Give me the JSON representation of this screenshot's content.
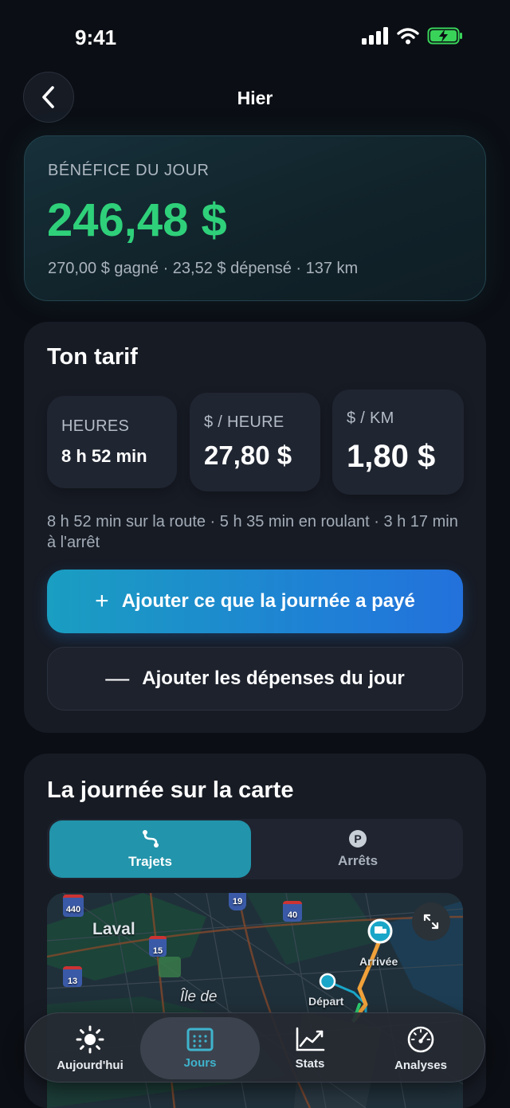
{
  "status_bar": {
    "time": "9:41"
  },
  "nav": {
    "title": "Hier"
  },
  "profit": {
    "label": "BÉNÉFICE DU JOUR",
    "value": "246,48 $",
    "summary": "270,00 $ gagné · 23,52 $ dépensé · 137 km"
  },
  "tarif": {
    "title": "Ton tarif",
    "tiles": [
      {
        "label": "HEURES",
        "value": "8 h 52 min"
      },
      {
        "label": "$ / HEURE",
        "value": "27,80 $"
      },
      {
        "label": "$ / KM",
        "value": "1,80 $"
      }
    ],
    "note": "8 h 52 min sur la route · 5 h 35 min en roulant · 3 h 17 min à l'arrêt",
    "add_paid_label": "Ajouter ce que la journée a payé",
    "add_expenses_label": "Ajouter les dépenses du jour"
  },
  "map_section": {
    "title": "La journée sur la carte",
    "tabs": [
      "Trajets",
      "Arrêts"
    ],
    "active_tab": "Trajets",
    "map_labels": {
      "city": "Laval",
      "island": "Île de",
      "start": "Départ",
      "end": "Arrivée",
      "shields": [
        "440",
        "19",
        "40",
        "15",
        "13"
      ]
    }
  },
  "tab_bar": {
    "items": [
      "Aujourd'hui",
      "Jours",
      "Stats",
      "Analyses"
    ],
    "active": "Jours"
  },
  "colors": {
    "profit_green": "#2fd07a",
    "accent_teal": "#2294ab",
    "button_blue": "#1f7fd6",
    "background": "#0b0e14"
  }
}
